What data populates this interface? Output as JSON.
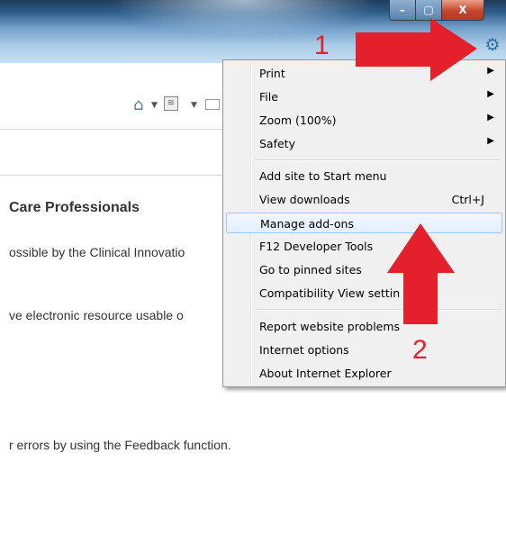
{
  "menu": {
    "items": [
      {
        "label": "Print",
        "submenu": true
      },
      {
        "label": "File",
        "submenu": true
      },
      {
        "label": "Zoom (100%)",
        "submenu": true
      },
      {
        "label": "Safety",
        "submenu": true
      },
      {
        "label": "Add site to Start menu"
      },
      {
        "label": "View downloads",
        "shortcut": "Ctrl+J"
      },
      {
        "label": "Manage add-ons",
        "highlighted": true
      },
      {
        "label": "F12 Developer Tools"
      },
      {
        "label": "Go to pinned sites"
      },
      {
        "label": "Compatibility View settin"
      },
      {
        "label": "Report website problems"
      },
      {
        "label": "Internet options"
      },
      {
        "label": "About Internet Explorer"
      }
    ]
  },
  "page": {
    "heading": "Care Professionals",
    "line1": "ossible by the Clinical Innovatio",
    "line2": "ve electronic resource usable o",
    "line3": "r errors by using the Feedback function."
  },
  "annotations": {
    "step1": "1",
    "step2": "2",
    "color": "#e3202b"
  },
  "window": {
    "minimize_glyph": "–",
    "maximize_glyph": "▢",
    "close_glyph": "X"
  },
  "icons": {
    "tools": "gear-icon",
    "favorites": "star-icon",
    "home": "home-icon",
    "feeds": "feeds-icon",
    "mail": "mail-icon"
  }
}
